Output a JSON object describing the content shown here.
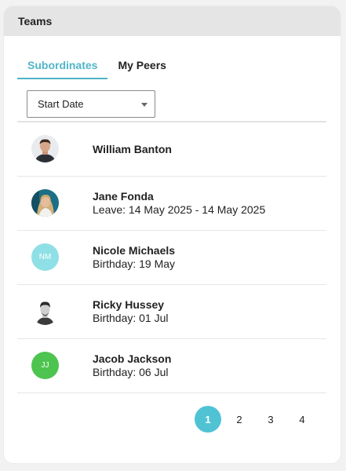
{
  "card": {
    "title": "Teams"
  },
  "tabs": [
    {
      "label": "Subordinates",
      "active": true
    },
    {
      "label": "My Peers",
      "active": false
    }
  ],
  "sort_select": {
    "value": "Start Date"
  },
  "people": [
    {
      "name": "William Banton",
      "detail": "",
      "avatar": {
        "type": "photo",
        "icon": "man-portrait-icon"
      }
    },
    {
      "name": "Jane Fonda",
      "detail": "Leave: 14 May 2025 - 14 May 2025",
      "avatar": {
        "type": "photo",
        "icon": "woman-portrait-icon"
      }
    },
    {
      "name": "Nicole Michaels",
      "detail": "Birthday: 19 May",
      "avatar": {
        "type": "initials",
        "initials": "NM",
        "color": "#8fe0e6"
      }
    },
    {
      "name": "Ricky Hussey",
      "detail": "Birthday: 01 Jul",
      "avatar": {
        "type": "photo",
        "icon": "man-portrait-icon"
      }
    },
    {
      "name": "Jacob Jackson",
      "detail": "Birthday: 06 Jul",
      "avatar": {
        "type": "initials",
        "initials": "JJ",
        "color": "#4dc44f"
      }
    }
  ],
  "pagination": {
    "pages": [
      "1",
      "2",
      "3",
      "4"
    ],
    "current": "1"
  },
  "colors": {
    "accent": "#4fb6c8",
    "page_active": "#4fc3d4"
  }
}
